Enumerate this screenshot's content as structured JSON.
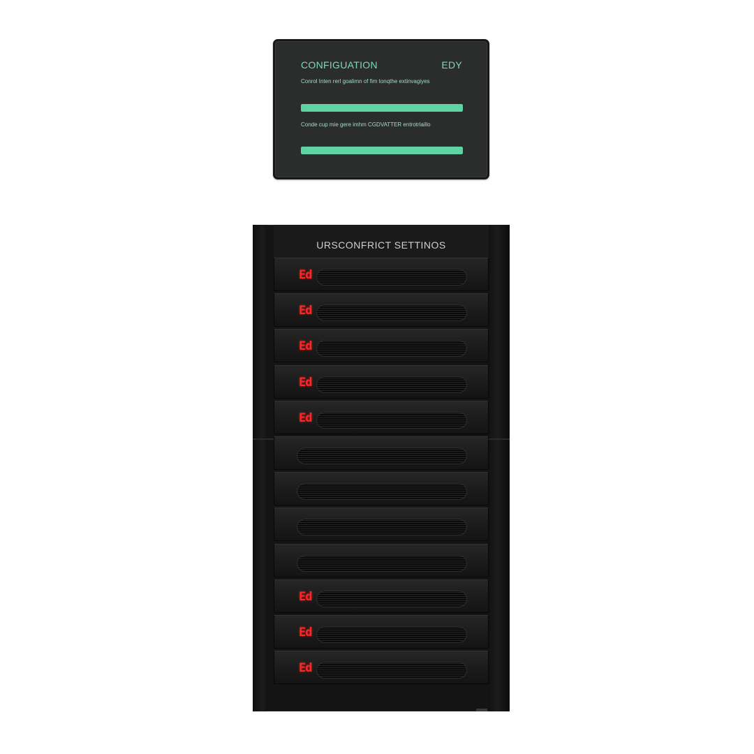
{
  "config_panel": {
    "title": "CONFIGUATION",
    "status": "EDY",
    "descriptions": [
      "Conrol Inten rerl goalimn of fim tonqthe extinvagiyes",
      "Conde cup mie gere imhm CGDVATTER entrotrlaillo"
    ],
    "progress": [
      1.0,
      1.0
    ],
    "accent_color": "#5fd3a3"
  },
  "tower": {
    "header_label": "URSCONFRICT SETTINOS",
    "led_color": "#ff2626",
    "bays": [
      {
        "id": 1,
        "led": "Ed"
      },
      {
        "id": 2,
        "led": "Ed"
      },
      {
        "id": 3,
        "led": "Ed"
      },
      {
        "id": 4,
        "led": "Ed"
      },
      {
        "id": 5,
        "led": "Ed"
      },
      {
        "id": 6,
        "led": ""
      },
      {
        "id": 7,
        "led": ""
      },
      {
        "id": 8,
        "led": ""
      },
      {
        "id": 9,
        "led": ""
      },
      {
        "id": 10,
        "led": "Ed"
      },
      {
        "id": 11,
        "led": "Ed"
      },
      {
        "id": 12,
        "led": "Ed"
      }
    ]
  }
}
